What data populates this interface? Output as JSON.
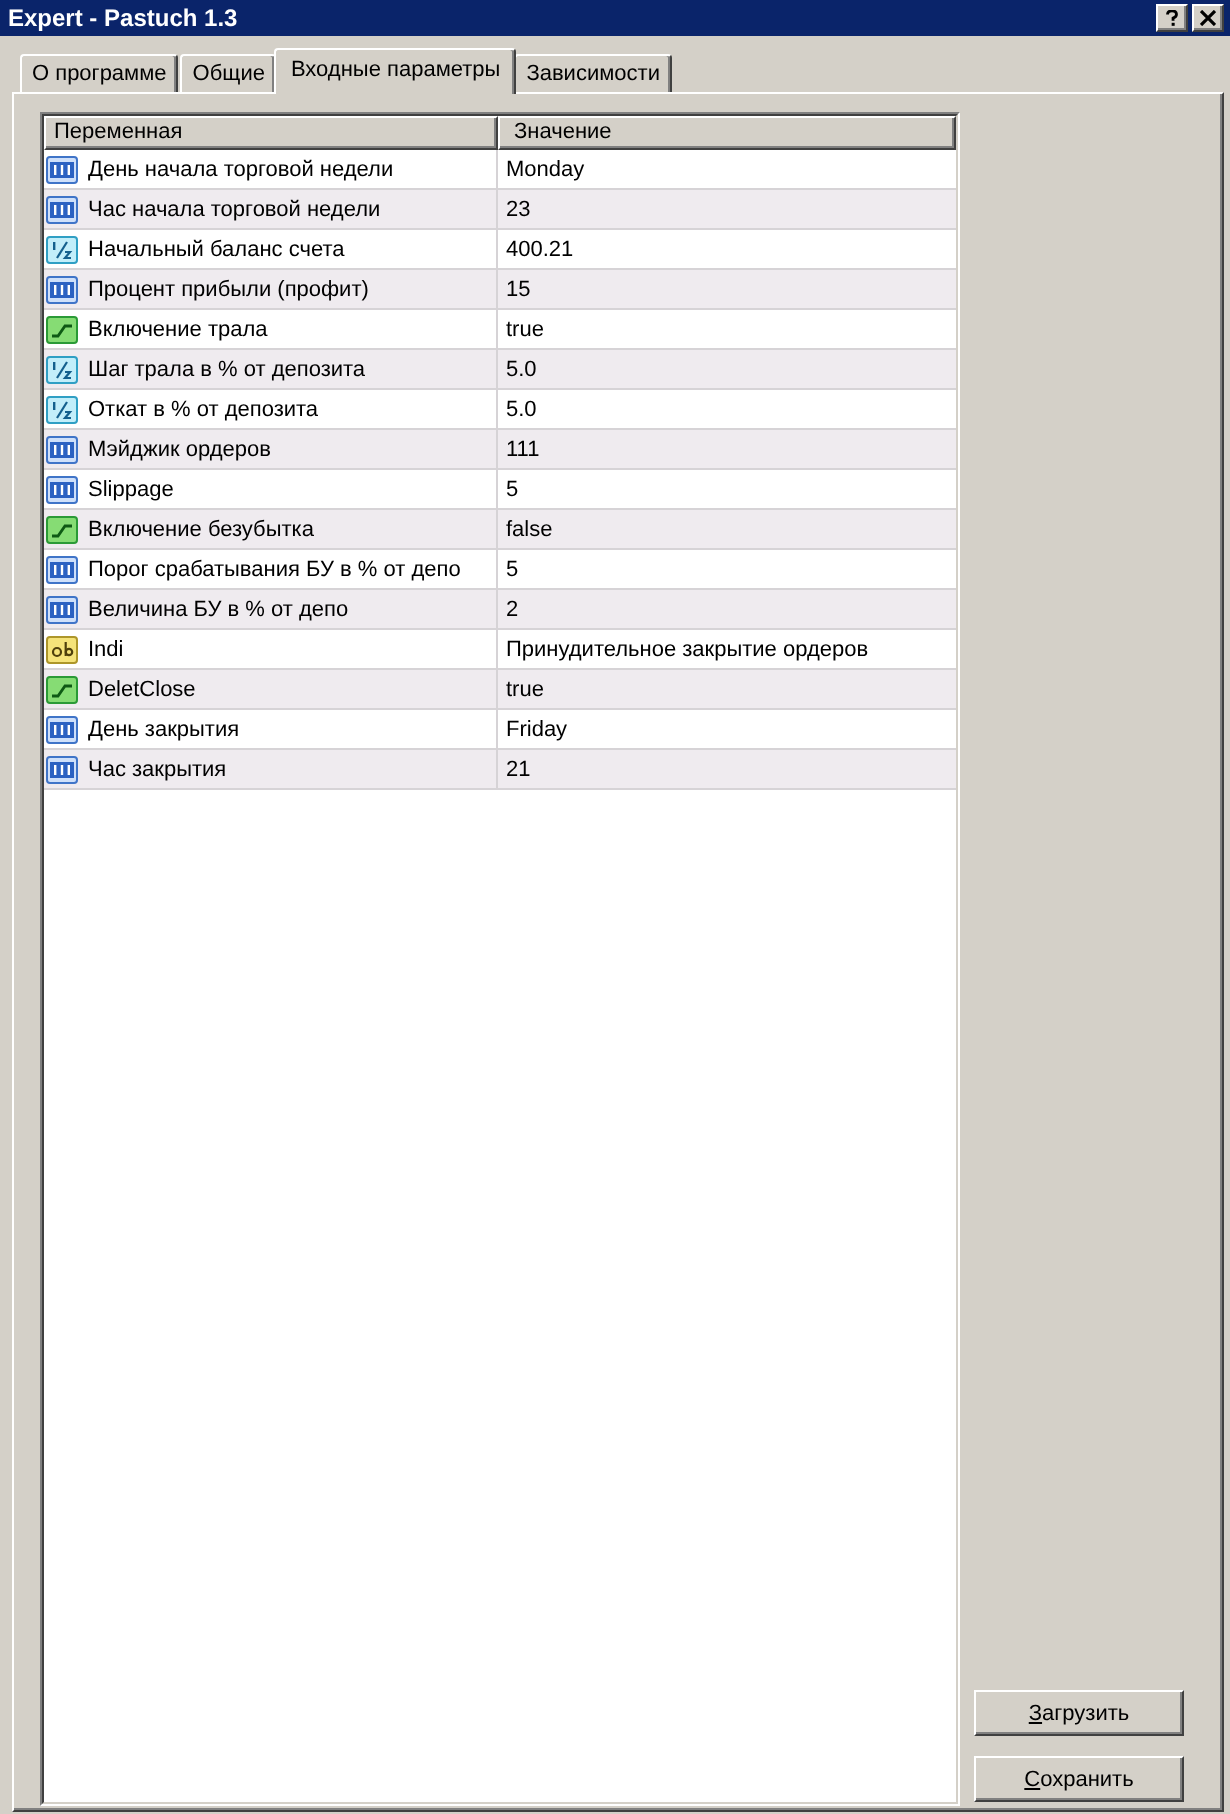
{
  "window": {
    "title": "Expert - Pastuch 1.3"
  },
  "tabs": [
    {
      "label": "О программе",
      "selected": false
    },
    {
      "label": "Общие",
      "selected": false
    },
    {
      "label": "Входные параметры",
      "selected": true
    },
    {
      "label": "Зависимости",
      "selected": false
    }
  ],
  "table": {
    "columns": [
      "Переменная",
      "Значение"
    ],
    "rows": [
      {
        "kind": "int",
        "name": "День начала торговой недели",
        "value": "Monday"
      },
      {
        "kind": "int",
        "name": "Час начала торговой недели",
        "value": "23"
      },
      {
        "kind": "double",
        "name": "Начальный баланс счета",
        "value": "400.21"
      },
      {
        "kind": "int",
        "name": "Процент прибыли (профит)",
        "value": "15"
      },
      {
        "kind": "bool",
        "name": "Включение трала",
        "value": "true"
      },
      {
        "kind": "double",
        "name": "Шаг трала в % от депозита",
        "value": "5.0"
      },
      {
        "kind": "double",
        "name": "Откат в % от депозита",
        "value": "5.0"
      },
      {
        "kind": "int",
        "name": "Мэйджик ордеров",
        "value": "111"
      },
      {
        "kind": "int",
        "name": "Slippage",
        "value": "5"
      },
      {
        "kind": "bool",
        "name": "Включение безубытка",
        "value": "false"
      },
      {
        "kind": "int",
        "name": "Порог срабатывания БУ в % от депо",
        "value": "5"
      },
      {
        "kind": "int",
        "name": "Величина БУ в % от депо",
        "value": "2"
      },
      {
        "kind": "string",
        "name": "Indi",
        "value": "Принудительное закрытие ордеров"
      },
      {
        "kind": "bool",
        "name": "DeletClose",
        "value": "true"
      },
      {
        "kind": "int",
        "name": "День закрытия",
        "value": "Friday"
      },
      {
        "kind": "int",
        "name": "Час закрытия",
        "value": "21"
      }
    ]
  },
  "buttons": [
    {
      "label": "Загрузить"
    },
    {
      "label": "Сохранить"
    }
  ]
}
